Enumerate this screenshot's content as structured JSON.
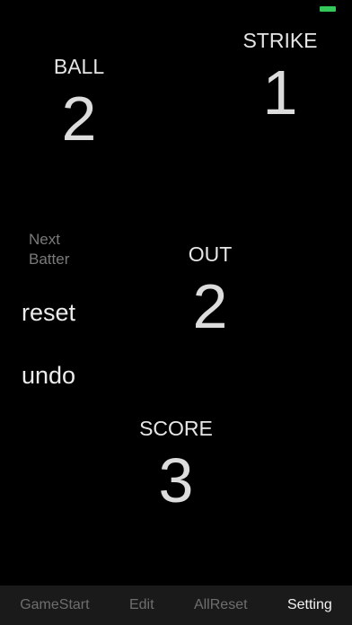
{
  "counters": {
    "ball": {
      "label": "BALL",
      "value": "2"
    },
    "strike": {
      "label": "STRIKE",
      "value": "1"
    },
    "out": {
      "label": "OUT",
      "value": "2"
    },
    "score": {
      "label": "SCORE",
      "value": "3"
    }
  },
  "actions": {
    "next_batter_line1": "Next",
    "next_batter_line2": "Batter",
    "reset_label": "reset",
    "undo_label": "undo"
  },
  "tabbar": {
    "tabs": [
      {
        "label": "GameStart"
      },
      {
        "label": "Edit"
      },
      {
        "label": "AllReset"
      },
      {
        "label": "Setting"
      }
    ],
    "active_tab": "Setting"
  },
  "colors": {
    "background": "#000000",
    "battery": "#34c759",
    "tabbar": "#1a1a1a",
    "inactive_tab": "#6e6e6e",
    "active_tab": "#f2f2f2"
  },
  "icons": {
    "status_bar": "battery-icon"
  }
}
